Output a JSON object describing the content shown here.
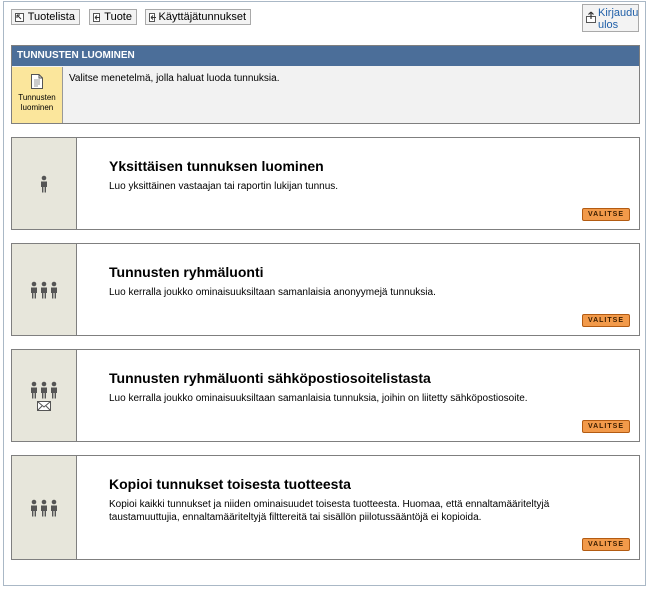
{
  "nav": {
    "product_list": "Tuotelista",
    "product": "Tuote",
    "user_ids": "Käyttäjätunnukset",
    "logout": "Kirjaudu ulos"
  },
  "header": {
    "title": "TUNNUSTEN LUOMINEN",
    "tile_label": "Tunnusten luominen",
    "description": "Valitse menetelmä, jolla haluat luoda tunnuksia."
  },
  "cards": [
    {
      "title": "Yksittäisen tunnuksen luominen",
      "description": "Luo yksittäinen vastaajan tai raportin lukijan tunnus.",
      "button": "VALITSE",
      "icon": "single-person-icon"
    },
    {
      "title": "Tunnusten ryhmäluonti",
      "description": "Luo kerralla joukko ominaisuuksiltaan samanlaisia anonyymejä tunnuksia.",
      "button": "VALITSE",
      "icon": "group-icon"
    },
    {
      "title": "Tunnusten ryhmäluonti sähköpostiosoitelistasta",
      "description": "Luo kerralla joukko ominaisuuksiltaan samanlaisia tunnuksia, joihin on liitetty sähköpostiosoite.",
      "button": "VALITSE",
      "icon": "group-email-icon"
    },
    {
      "title": "Kopioi tunnukset toisesta tuotteesta",
      "description": "Kopioi kaikki tunnukset ja niiden ominaisuudet toisesta tuotteesta. Huomaa, että ennaltamääriteltyjä taustamuuttujia, ennaltamääriteltyjä filttereitä tai sisällön piilotussääntöjä ei kopioida.",
      "button": "VALITSE",
      "icon": "group-copy-icon"
    }
  ]
}
